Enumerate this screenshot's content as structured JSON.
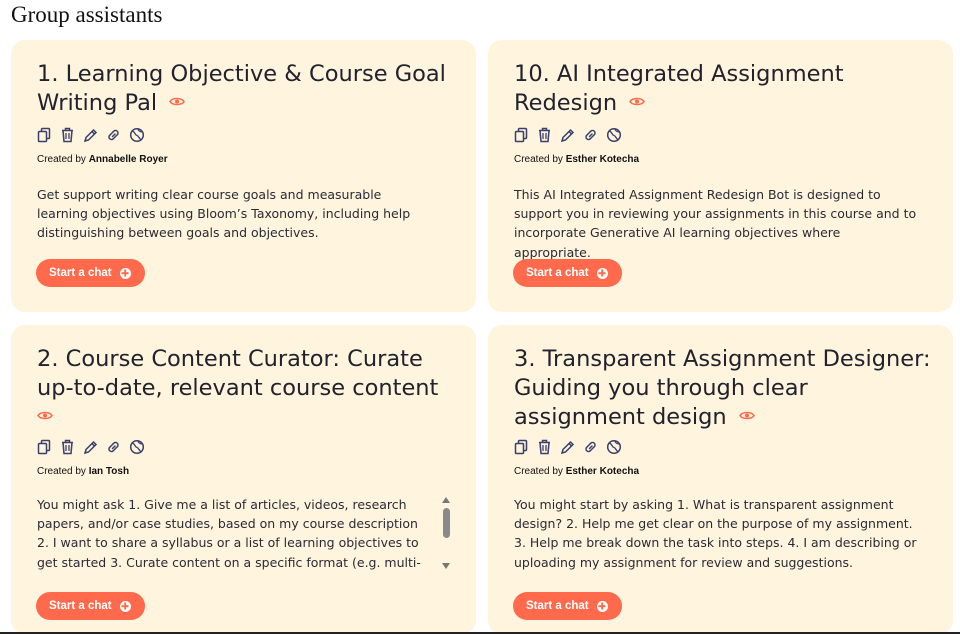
{
  "page": {
    "title": "Group assistants"
  },
  "icons": [
    "copy-icon",
    "trash-icon",
    "edit-icon",
    "link-icon",
    "globe-icon"
  ],
  "colors": {
    "card_bg": "#fff4de",
    "accent": "#ff6a4d",
    "icon": "#3a3f6b"
  },
  "cards": [
    {
      "title": "1. Learning Objective & Course Goal Writing Pal",
      "created_prefix": "Created by",
      "author": "Annabelle Royer",
      "description": "Get support writing clear course goals and measurable learning objectives using Bloom’s Taxonomy, including help distinguishing between goals and objectives.",
      "button": "Start a chat"
    },
    {
      "title": "10. AI Integrated Assignment Redesign",
      "created_prefix": "Created by",
      "author": "Esther Kotecha",
      "description": "This AI Integrated Assignment Redesign Bot is designed to support you in reviewing your assignments in this course and to incorporate Generative AI learning objectives where appropriate.",
      "button": "Start a chat"
    },
    {
      "title": "2. Course Content Curator: Curate up-to-date, relevant course content",
      "created_prefix": "Created by",
      "author": "Ian Tosh",
      "description": "You might ask 1. Give me a list of articles, videos, research papers, and/or case studies, based on my course description 2. I want to share a syllabus or a list of learning objectives to get started 3. Curate content on a specific format (e.g. multi-media resources",
      "button": "Start a chat"
    },
    {
      "title": "3. Transparent Assignment Designer: Guiding you through clear assignment design",
      "created_prefix": "Created by",
      "author": "Esther Kotecha",
      "description": "You might start by asking 1. What is transparent assignment design? 2. Help me get clear on the purpose of my assignment. 3. Help me break down the task into steps. 4. I am describing or uploading my assignment for review and suggestions.",
      "button": "Start a chat"
    }
  ]
}
